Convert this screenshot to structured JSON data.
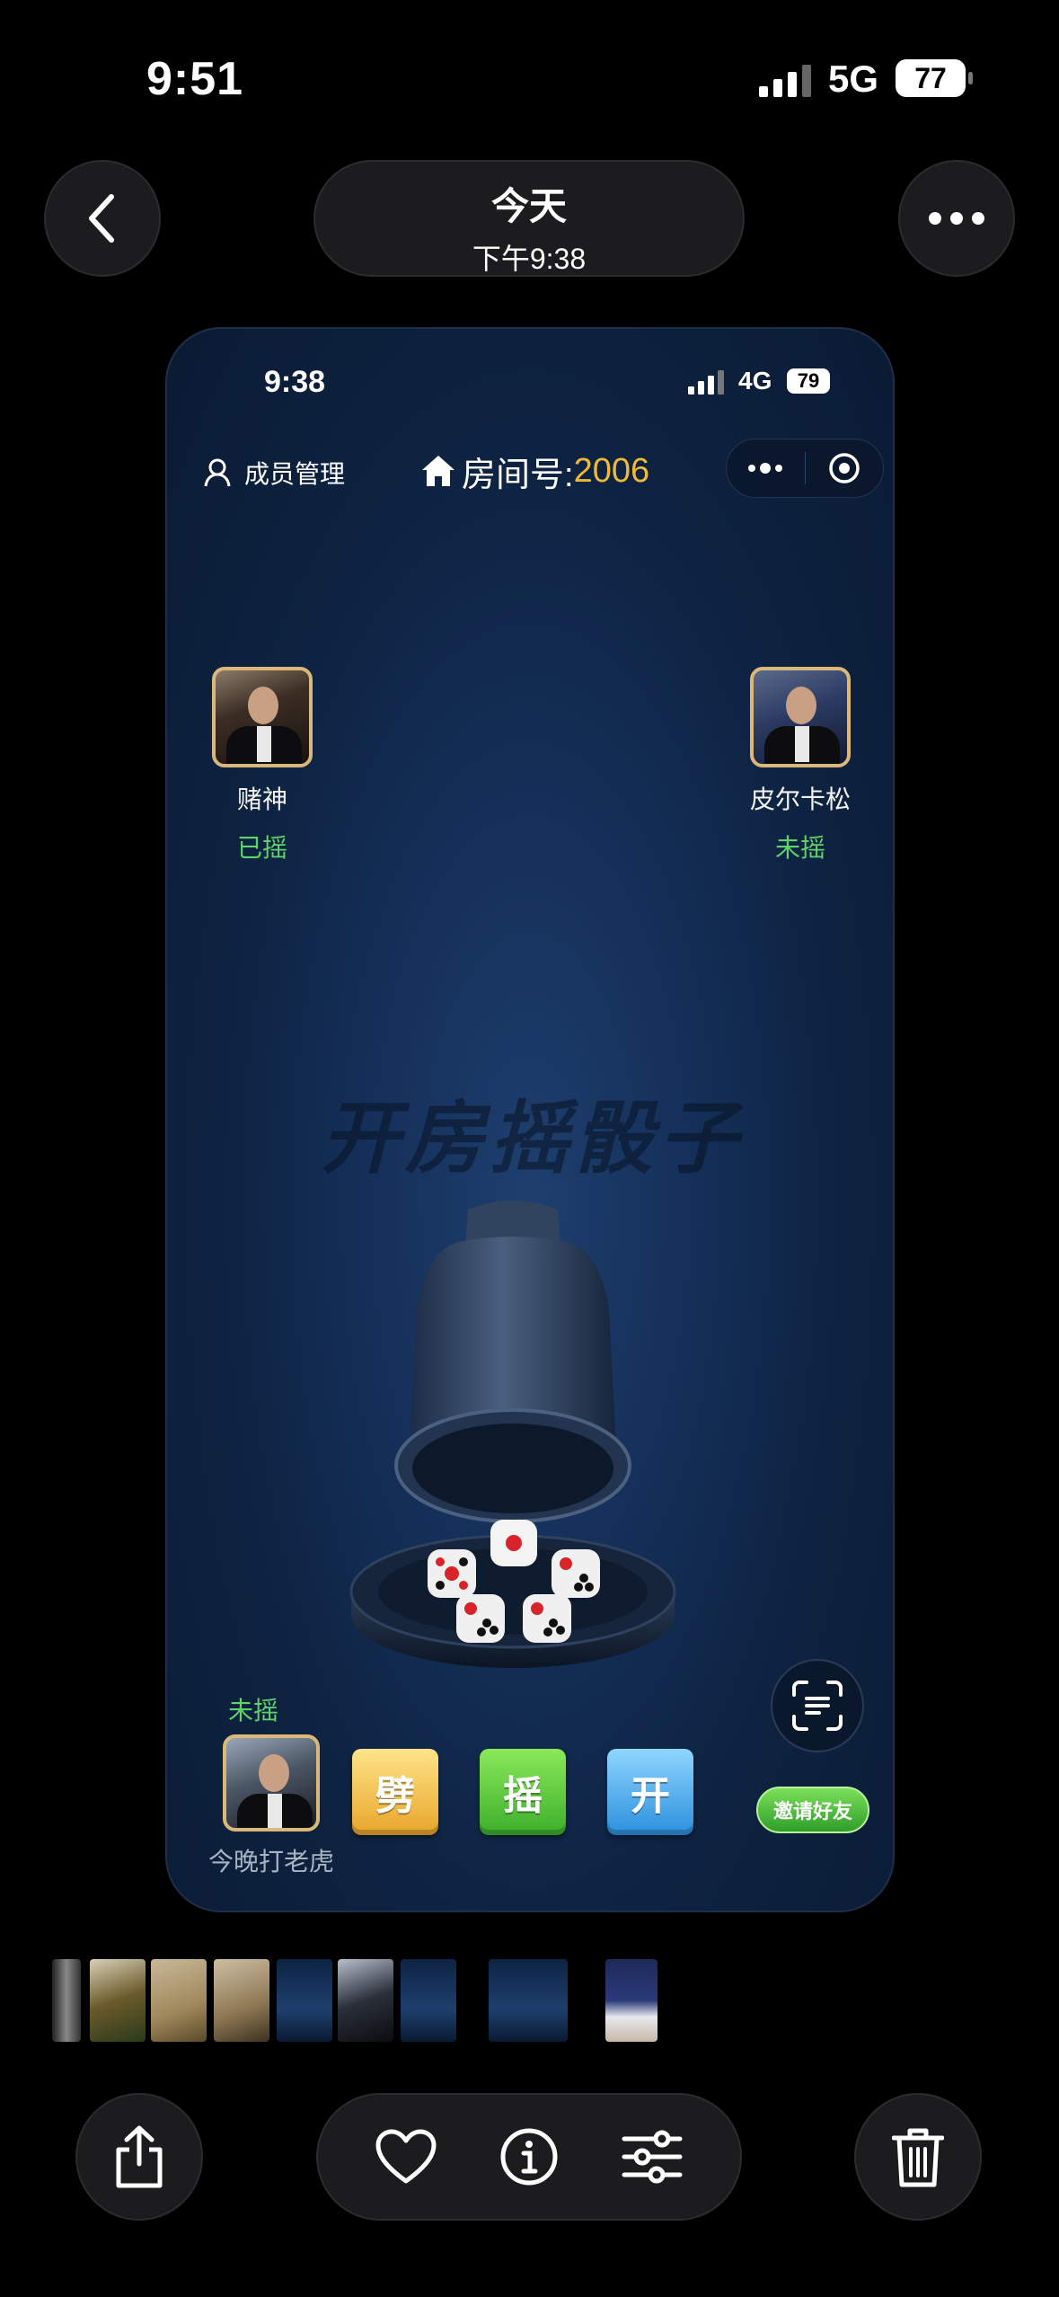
{
  "status_bar": {
    "time": "9:51",
    "network": "5G",
    "battery": "77"
  },
  "nav": {
    "title": "今天",
    "subtitle": "下午9:38"
  },
  "screenshot": {
    "status_bar": {
      "time": "9:38",
      "network": "4G",
      "battery": "79"
    },
    "header": {
      "member_mgmt_label": "成员管理",
      "room_label": "房间号:",
      "room_number": "2006"
    },
    "players": [
      {
        "name": "赌神",
        "status": "已摇"
      },
      {
        "name": "皮尔卡松",
        "status": "未摇"
      }
    ],
    "watermark": "开房摇骰子",
    "self": {
      "name": "今晚打老虎",
      "status": "未摇"
    },
    "actions": {
      "split": "劈",
      "shake": "摇",
      "open": "开"
    },
    "invite_label": "邀请好友"
  },
  "colors": {
    "room_number": "#f0b93a",
    "status_green": "#5fd46a",
    "avatar_border": "#d9b87a"
  }
}
